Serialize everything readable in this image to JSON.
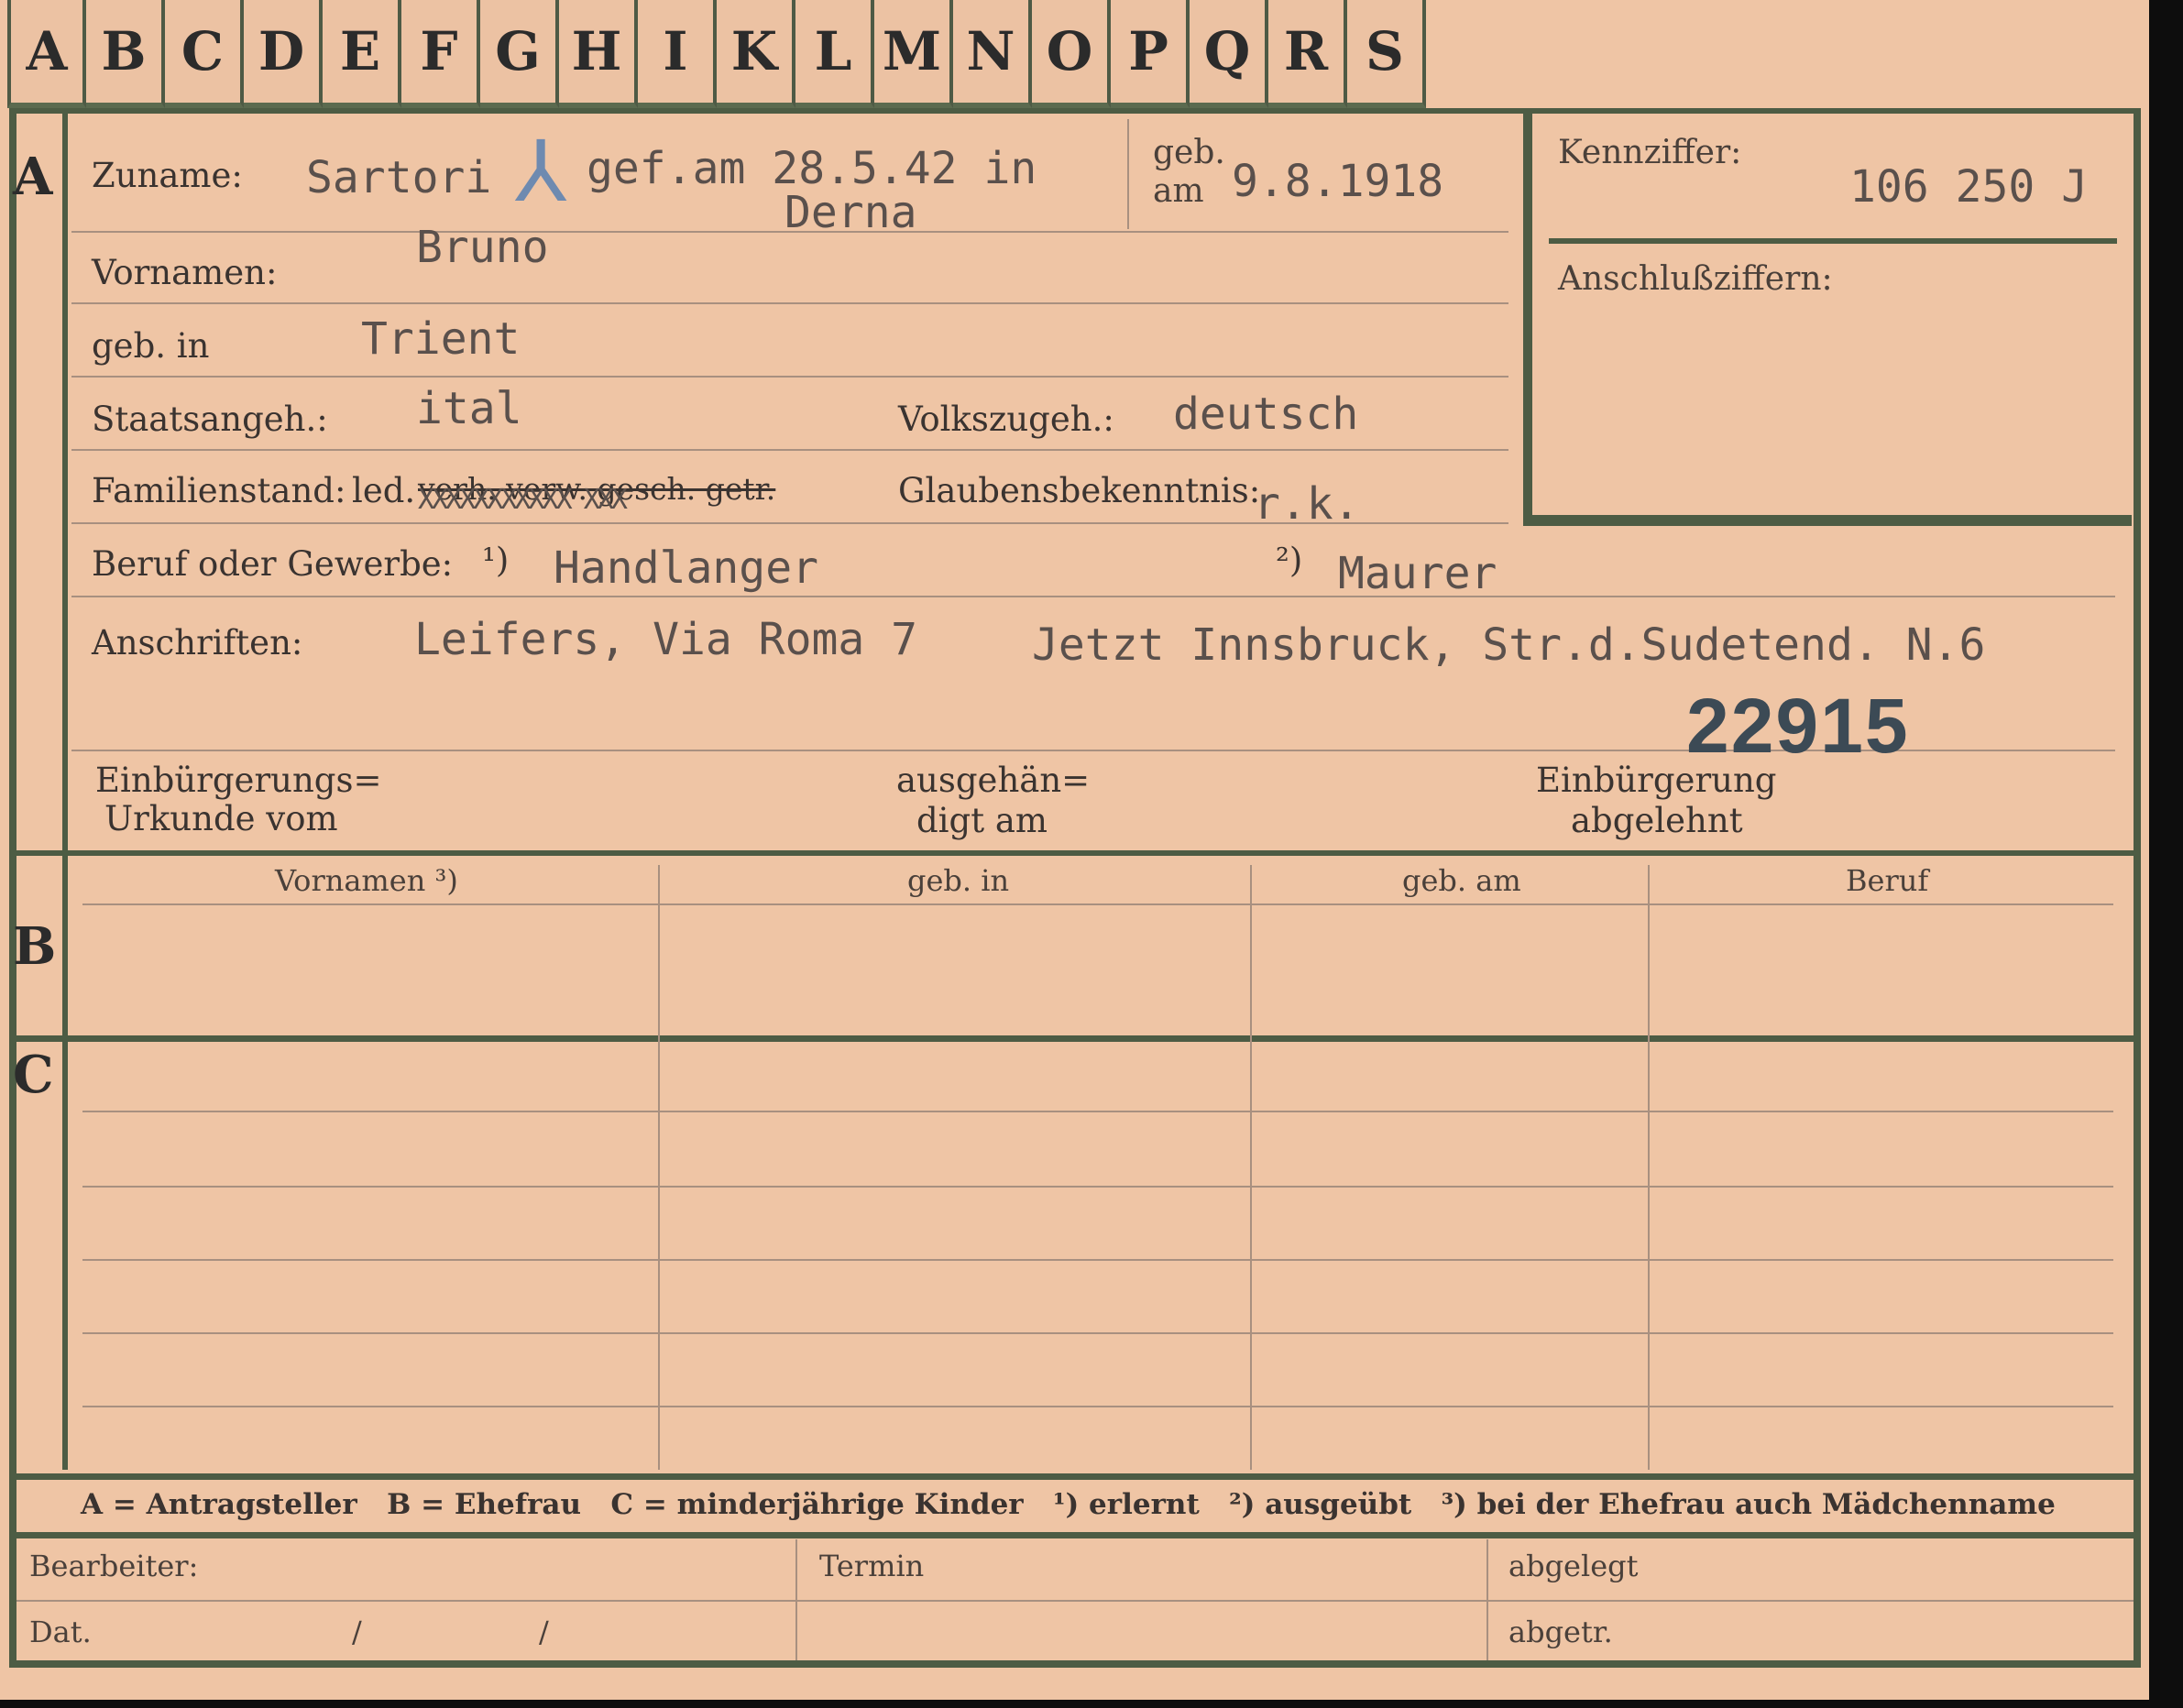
{
  "tabs": [
    "A",
    "B",
    "C",
    "D",
    "E",
    "F",
    "G",
    "H",
    "I",
    "K",
    "L",
    "M",
    "N",
    "O",
    "P",
    "Q",
    "R",
    "S"
  ],
  "section_labels": {
    "a": "A",
    "b": "B",
    "c": "C"
  },
  "fields": {
    "zuname_label": "Zuname:",
    "zuname_value": "Sartori",
    "death_symbol": "⅄",
    "death_note_1": "gef.am 28.5.42 in",
    "death_note_2": "Derna",
    "geb_am_label_1": "geb.",
    "geb_am_label_2": "am",
    "geb_am_value": "9.8.1918",
    "vornamen_label": "Vornamen:",
    "vornamen_value": "Bruno",
    "geb_in_label": "geb. in",
    "geb_in_value": "Trient",
    "staat_label": "Staatsangeh.:",
    "staat_value": "ital",
    "volk_label": "Volkszugeh.:",
    "volk_value": "deutsch",
    "familie_label": "Familienstand:",
    "familie_led": "led.",
    "familie_struck": "verh. verw. gesch. getr.",
    "familie_xs": "XXXXXXXXXXX XXX",
    "glaube_label": "Glaubensbekenntnis:",
    "glaube_value": "r.k.",
    "beruf_label": "Beruf oder Gewerbe:",
    "beruf_1_marker": "¹)",
    "beruf_1_value": "Handlanger",
    "beruf_2_marker": "²)",
    "beruf_2_value": "Maurer",
    "anschriften_label": "Anschriften:",
    "anschriften_1": "Leifers, Via Roma 7",
    "anschriften_2": "Jetzt Innsbruck, Str.d.Sudetend. N.6",
    "stamp_number": "22915",
    "einb_urkunde_1": "Einbürgerungs=",
    "einb_urkunde_2": "Urkunde vom",
    "ausgehaen_1": "ausgehän=",
    "ausgehaen_2": "digt am",
    "einb_abgelehnt_1": "Einbürgerung",
    "einb_abgelehnt_2": "abgelehnt",
    "kennziffer_label": "Kennziffer:",
    "kennziffer_value": "106 250 J",
    "anschluss_label": "Anschlußziffern:"
  },
  "table_b_headers": [
    "Vornamen ³)",
    "geb. in",
    "geb. am",
    "Beruf"
  ],
  "legend": "A = Antragsteller   B = Ehefrau   C = minderjährige Kinder   ¹) erlernt   ²) ausgeübt   ³) bei der Ehefrau auch Mädchenname",
  "footer": {
    "bearbeiter": "Bearbeiter:",
    "dat": "Dat.",
    "slash_1": "/",
    "slash_2": "/",
    "termin": "Termin",
    "abgelegt": "abgelegt",
    "abgetr": "abgetr."
  },
  "colors": {
    "card": "#efc5a5",
    "rule": "#4d5c44",
    "ink": "#5a504c",
    "stamp": "#3c4a55",
    "background": "#0d0d0d"
  }
}
